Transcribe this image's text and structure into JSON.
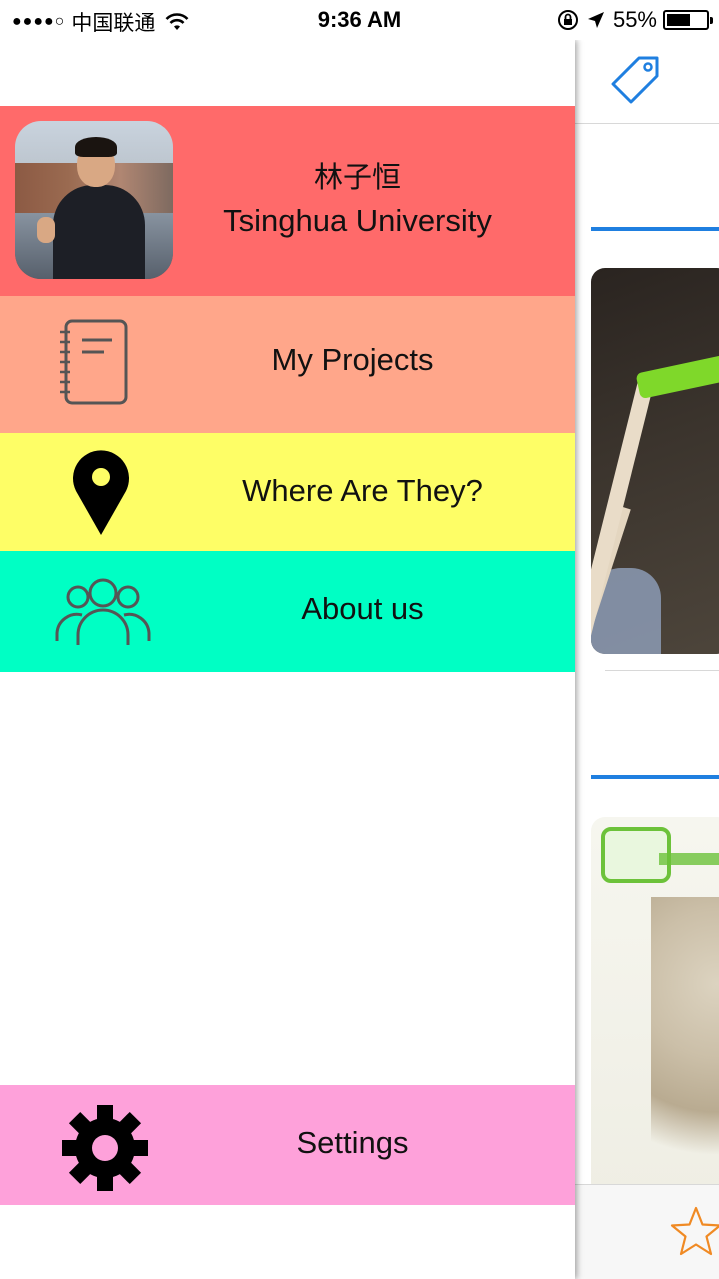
{
  "status_bar": {
    "signal": "●●●●○",
    "carrier": "中国联通",
    "time": "9:36 AM",
    "battery_percent": "55%",
    "battery_level": 0.55
  },
  "drawer": {
    "profile": {
      "name": "林子恒",
      "school": "Tsinghua University"
    },
    "menu": [
      {
        "label": "My Projects",
        "icon": "notebook-icon",
        "color": "#ffa68a"
      },
      {
        "label": "Where Are They?",
        "icon": "map-pin-icon",
        "color": "#fefe66"
      },
      {
        "label": "About us",
        "icon": "people-icon",
        "color": "#00ffc4"
      }
    ],
    "settings": {
      "label": "Settings",
      "icon": "gear-icon",
      "color": "#fea1da"
    },
    "profile_color": "#ff6a6a"
  },
  "content": {
    "top_icon": "tag-icon",
    "accent_color": "#1f7fe0",
    "bottom_icon": "star-icon",
    "star_color": "#f08a24"
  }
}
